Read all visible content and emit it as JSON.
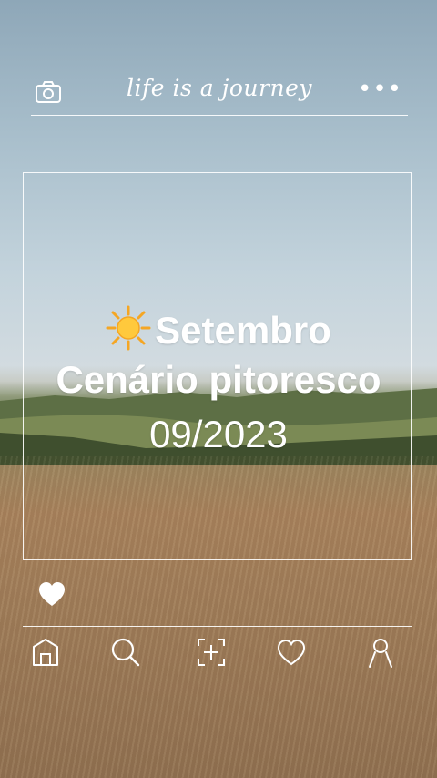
{
  "app": {
    "brand_text": "life is a journey"
  },
  "topbar": {
    "camera_icon": "camera-icon",
    "more_label": "•••"
  },
  "post": {
    "line1": "Setembro",
    "line2": "Cenário pitoresco",
    "line3": "09/2023",
    "emoji_icon": "sun-icon"
  },
  "nav": {
    "items": [
      {
        "icon": "home-icon"
      },
      {
        "icon": "search-icon"
      },
      {
        "icon": "add-post-icon"
      },
      {
        "icon": "heart-icon"
      },
      {
        "icon": "profile-icon"
      }
    ]
  },
  "colors": {
    "line": "#ffffff",
    "sky": "#c3d3dc",
    "field": "#a47f5a"
  }
}
